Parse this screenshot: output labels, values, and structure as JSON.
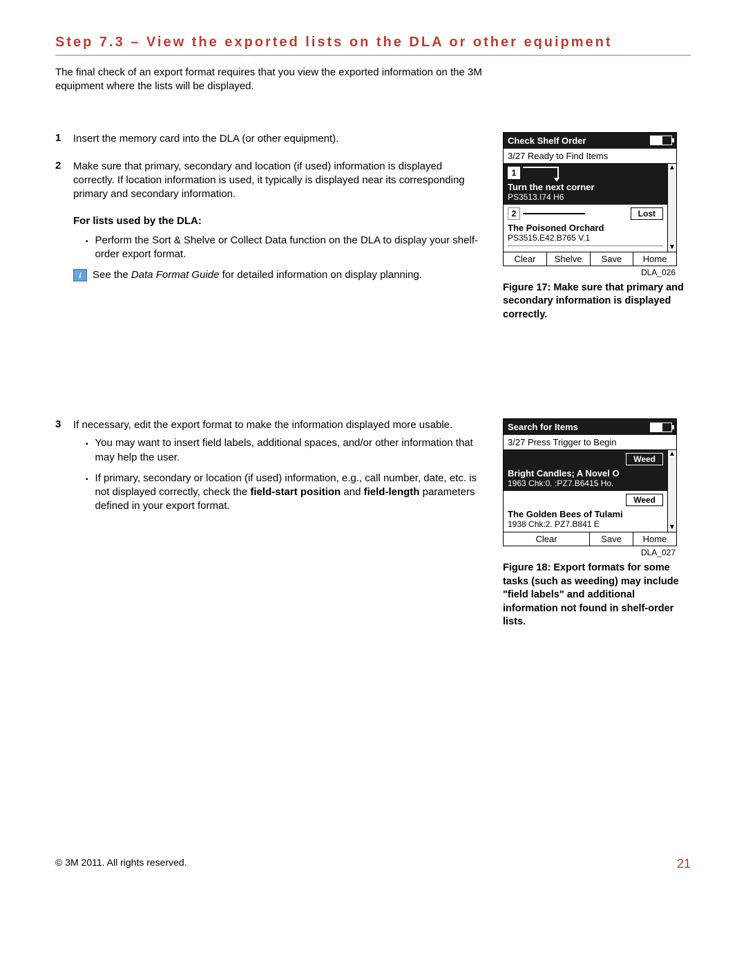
{
  "title": "Step 7.3 – View the exported lists on the DLA or other equipment",
  "intro": "The final check of an export format requires that you view the exported information on the 3M equipment where the lists will be displayed.",
  "steps": {
    "s1": {
      "num": "1",
      "text": "Insert the memory card into the DLA (or other equipment)."
    },
    "s2": {
      "num": "2",
      "text": "Make sure that primary, secondary and location (if used) information is displayed correctly. If location information is used, it typically is displayed near its corresponding primary and secondary information.",
      "subheading": "For lists used by the DLA:",
      "bullet1": "Perform the Sort & Shelve or Collect Data function on the DLA to display your shelf-order export format.",
      "info_prefix": "See the ",
      "info_italic": "Data Format Guide",
      "info_suffix": " for detailed information on display planning."
    },
    "s3": {
      "num": "3",
      "text": "If necessary, edit the export format to make the information displayed more usable.",
      "bullet1": "You may want to insert field labels, additional spaces, and/or other information that may help the user.",
      "bullet2a": "If primary, secondary or location (if used) information, e.g., call number, date, etc. is not displayed correctly, check the ",
      "bullet2b": "field-start position",
      "bullet2c": " and ",
      "bullet2d": "field-length",
      "bullet2e": " parameters defined in your export format."
    }
  },
  "fig1": {
    "header": "Check Shelf Order",
    "status": "3/27  Ready to Find Items",
    "box1": "1",
    "item1_title": "Turn the next corner",
    "item1_sub": "PS3513.I74 H6",
    "box2": "2",
    "pill2": "Lost",
    "item2_title": "The Poisoned Orchard",
    "item2_sub": "PS3515.E42.B765 V.1",
    "buttons": [
      "Clear",
      "Shelve",
      "Save",
      "Home"
    ],
    "id": "DLA_026",
    "caption": "Figure 17: Make sure that primary and secondary information is displayed correctly."
  },
  "fig2": {
    "header": "Search for Items",
    "status": "3/27  Press Trigger to Begin",
    "pill1": "Weed",
    "item1_title": "Bright Candles; A Novel O",
    "item1_sub": "1963 Chk:0. :PZ7.B6415 Ho.",
    "pill2": "Weed",
    "item2_title": "The Golden Bees of Tulami",
    "item2_sub": "1938 Chk:2. PZ7.B841 E",
    "buttons": [
      "Clear",
      "Save",
      "Home"
    ],
    "id": "DLA_027",
    "caption": "Figure 18: Export formats for some tasks (such as weeding) may include \"field labels\" and additional information not found in shelf-order lists."
  },
  "footer": {
    "copyright": "© 3M 2011. All rights reserved.",
    "page": "21"
  }
}
